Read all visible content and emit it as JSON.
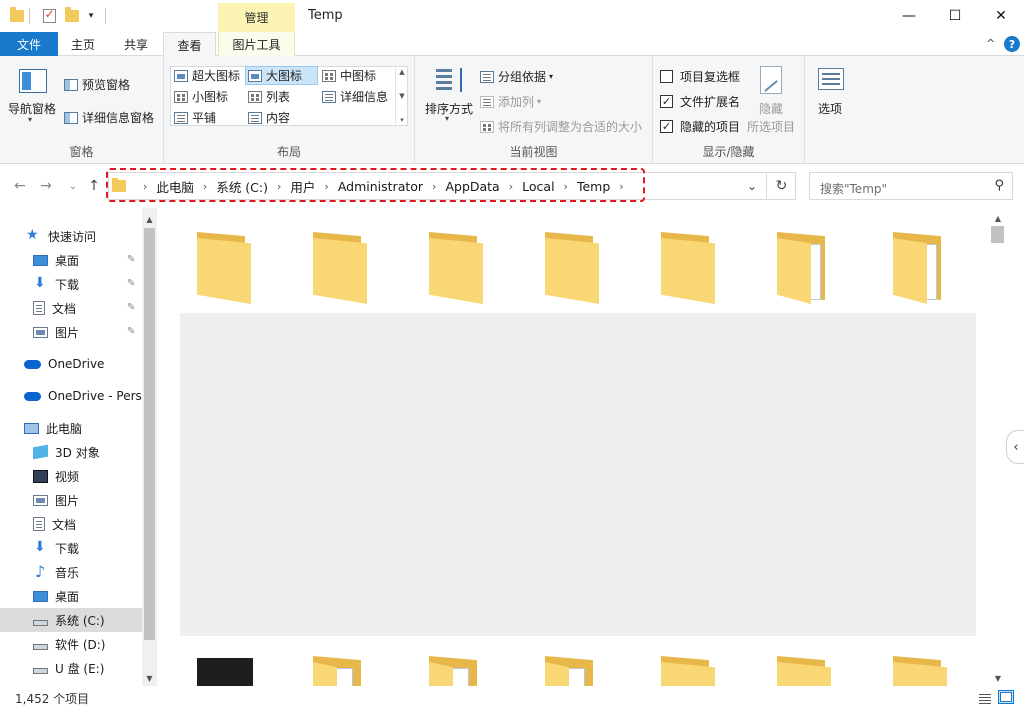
{
  "window": {
    "title": "Temp",
    "context_tab": "管理",
    "minimize": "—",
    "maximize": "☐",
    "close": "✕"
  },
  "tabs": {
    "file": "文件",
    "home": "主页",
    "share": "共享",
    "view": "查看",
    "picture_tools": "图片工具",
    "collapse": "^",
    "help": "?"
  },
  "ribbon": {
    "panes": {
      "label": "窗格",
      "nav_pane": "导航窗格",
      "preview_pane": "预览窗格",
      "details_pane": "详细信息窗格"
    },
    "layout": {
      "label": "布局",
      "items": [
        "超大图标",
        "大图标",
        "中图标",
        "小图标",
        "列表",
        "详细信息",
        "平铺",
        "内容"
      ],
      "selected": "大图标"
    },
    "current_view": {
      "label": "当前视图",
      "sort_by": "排序方式",
      "group_by": "分组依据",
      "add_column": "添加列",
      "fit_columns": "将所有列调整为合适的大小"
    },
    "show_hide": {
      "label": "显示/隐藏",
      "item_checkboxes": "项目复选框",
      "item_checkboxes_checked": false,
      "file_extensions": "文件扩展名",
      "file_extensions_checked": true,
      "hidden_items": "隐藏的项目",
      "hidden_items_checked": true,
      "hide_selected_1": "隐藏",
      "hide_selected_2": "所选项目"
    },
    "options": "选项"
  },
  "address": {
    "crumbs": [
      "此电脑",
      "系统 (C:)",
      "用户",
      "Administrator",
      "AppData",
      "Local",
      "Temp"
    ],
    "search_placeholder": "搜索\"Temp\""
  },
  "sidebar": {
    "items": [
      {
        "label": "快速访问",
        "icon": "star-icon"
      },
      {
        "label": "桌面",
        "icon": "desktop-icon",
        "pinned": true
      },
      {
        "label": "下载",
        "icon": "download-icon",
        "pinned": true
      },
      {
        "label": "文档",
        "icon": "document-icon",
        "pinned": true
      },
      {
        "label": "图片",
        "icon": "picture-icon",
        "pinned": true
      },
      {
        "label": "OneDrive",
        "icon": "cloud-icon"
      },
      {
        "label": "OneDrive - Perso",
        "icon": "cloud-icon"
      },
      {
        "label": "此电脑",
        "icon": "computer-icon"
      },
      {
        "label": "3D 对象",
        "icon": "3d-objects-icon"
      },
      {
        "label": "视频",
        "icon": "video-icon"
      },
      {
        "label": "图片",
        "icon": "picture-icon"
      },
      {
        "label": "文档",
        "icon": "document-icon"
      },
      {
        "label": "下载",
        "icon": "download-icon"
      },
      {
        "label": "音乐",
        "icon": "music-icon"
      },
      {
        "label": "桌面",
        "icon": "desktop-icon"
      },
      {
        "label": "系统 (C:)",
        "icon": "drive-icon",
        "selected": true
      },
      {
        "label": "软件 (D:)",
        "icon": "drive-icon"
      },
      {
        "label": "U 盘 (E:)",
        "icon": "drive-icon"
      }
    ]
  },
  "status": {
    "item_count": "1,452 个项目"
  },
  "colors": {
    "accent": "#1979ca",
    "folder": "#fad775",
    "highlight": "#e0171f"
  }
}
